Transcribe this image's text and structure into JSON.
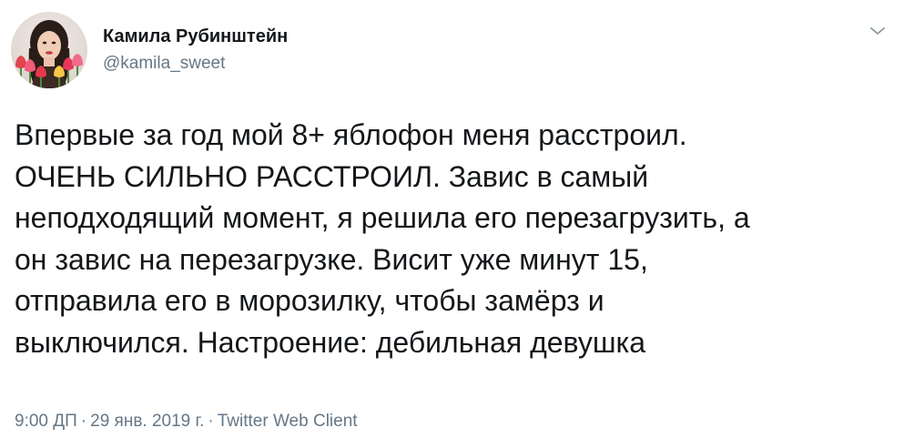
{
  "user": {
    "display_name": "Камила Рубинштейн",
    "handle": "@kamila_sweet",
    "avatar_icon": "profile-photo-with-tulips"
  },
  "menu": {
    "icon": "chevron-down-icon"
  },
  "tweet": {
    "lines": [
      "Впервые за год мой 8+ яблофон меня расстроил.",
      "ОЧЕНЬ СИЛЬНО РАССТРОИЛ. Завис в самый",
      "неподходящий момент, я решила его перезагрузить, а",
      "он завис на перезагрузке. Висит уже минут 15,",
      "отправила его в морозилку, чтобы замёрз и",
      "выключился. Настроение: дебильная девушка"
    ]
  },
  "meta": {
    "time": "9:00 ДП",
    "separator": "·",
    "date": "29 янв. 2019 г.",
    "client": "Twitter Web Client"
  },
  "colors": {
    "text": "#14171a",
    "secondary": "#657786",
    "background": "#ffffff"
  }
}
